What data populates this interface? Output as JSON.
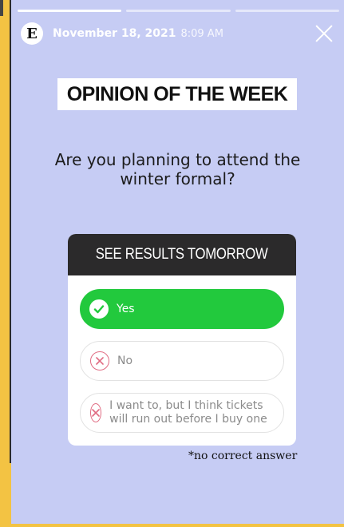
{
  "header": {
    "avatar_letter": "E",
    "date": "November 18, 2021",
    "time": "8:09 AM"
  },
  "headline": "OPINION OF THE WEEK",
  "question": "Are you planning to attend the winter formal?",
  "poll": {
    "title": "SEE RESULTS TOMORROW",
    "options": [
      {
        "label": "Yes",
        "selected": true
      },
      {
        "label": "No",
        "selected": false
      },
      {
        "label": "I want to, but I think tickets will run out before I buy one",
        "selected": false
      }
    ]
  },
  "footnote": "*no correct answer",
  "colors": {
    "background": "#c6ccf4",
    "frame": "#f3c343",
    "selected": "#22c93d",
    "poll_header": "#2b2a2b",
    "incorrect_mark": "#e06b82"
  },
  "progress": {
    "total_segments": 3,
    "completed_segments": 1
  }
}
